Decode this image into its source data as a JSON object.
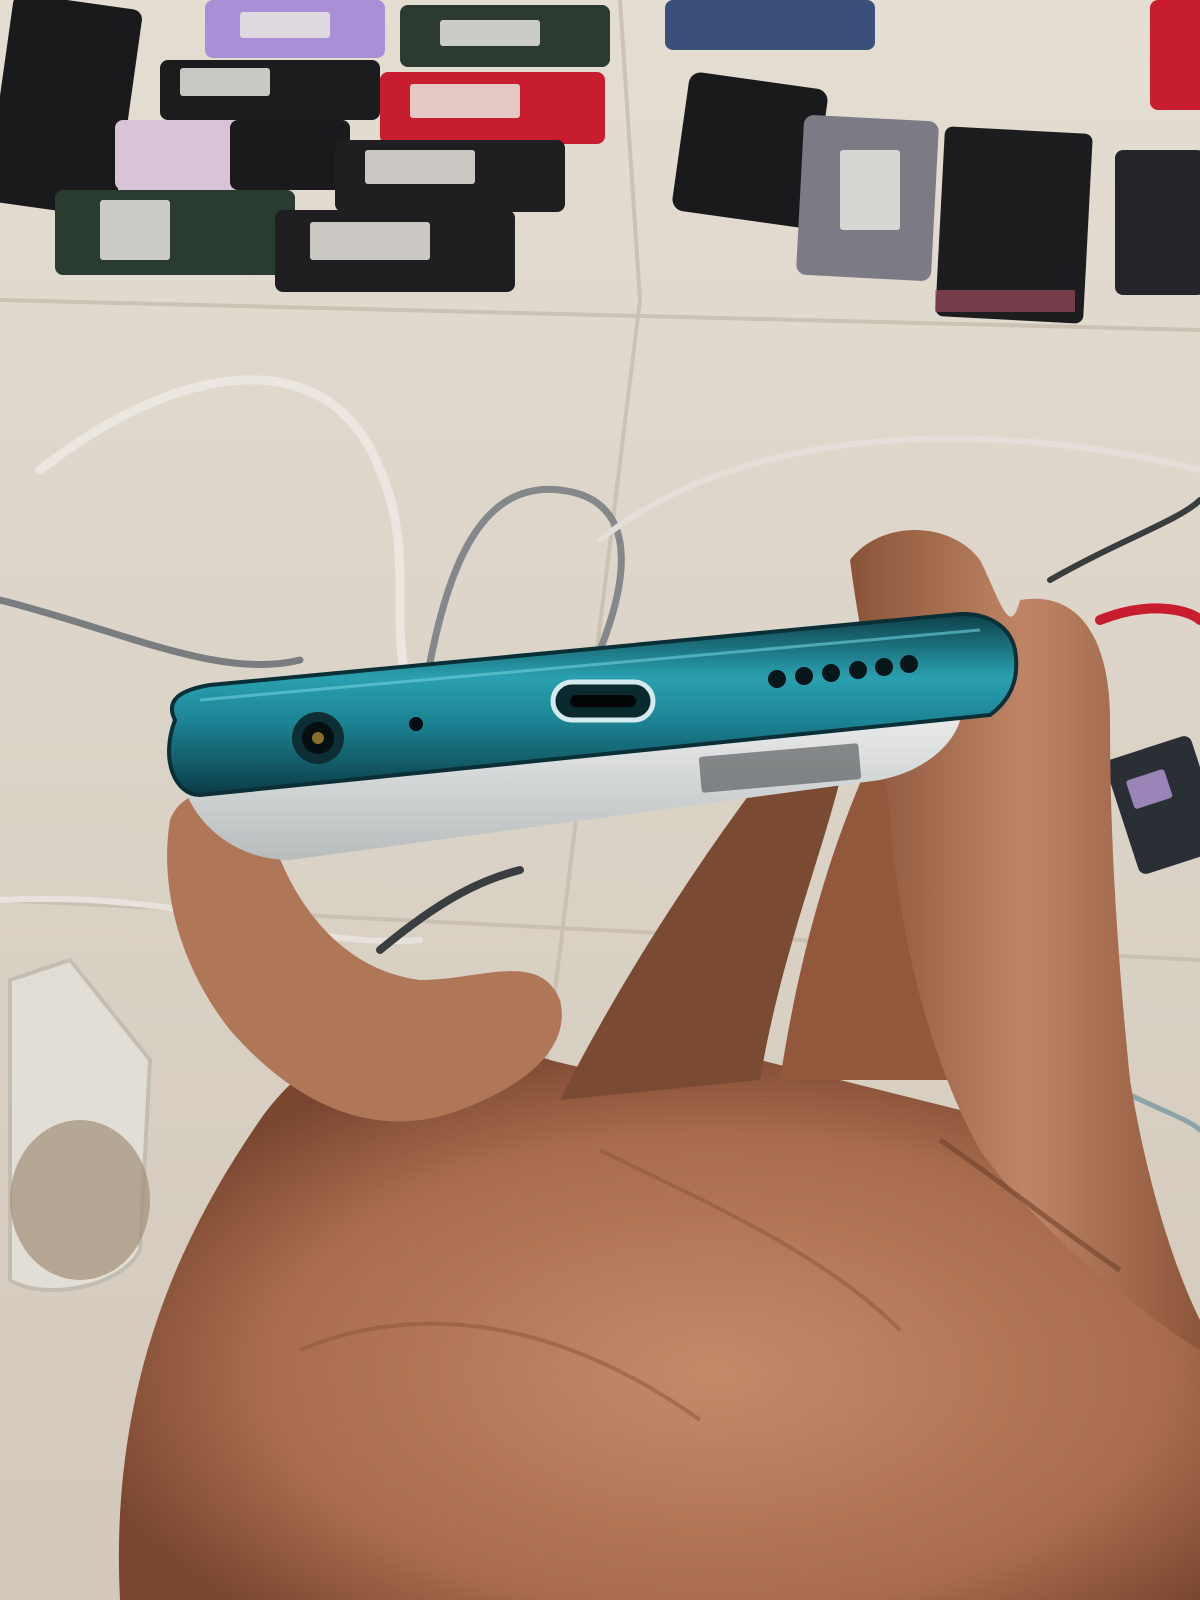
{
  "scene": {
    "description_label": "",
    "colors": {
      "floor": "#d9d1c6",
      "floor_light": "#ece7dd",
      "tile_grout": "#c9c0b2",
      "phone_body_teal": "#1f8a9a",
      "phone_body_dark": "#0f4f5b",
      "phone_back": "#d6d9da",
      "skin": "#b57a5c",
      "skin_shadow": "#7e4b33",
      "skin_highlight": "#d49b7c",
      "cable_white": "#e8e4dd",
      "cable_gray": "#8a8d8e",
      "accent_red": "#c81d2f"
    },
    "background_phones": [
      {
        "color": "#a98fd6"
      },
      {
        "color": "#2c3a2f"
      },
      {
        "color": "#1c1c1f"
      },
      {
        "color": "#c81d2f"
      },
      {
        "color": "#d8c3d8"
      },
      {
        "color": "#1a1a1c"
      },
      {
        "color": "#2a3b2f"
      },
      {
        "color": "#1f1f22"
      },
      {
        "color": "#3a4f7a"
      },
      {
        "color": "#1a1a1c"
      },
      {
        "color": "#7c7a84"
      },
      {
        "color": "#1d1d20"
      },
      {
        "color": "#24252a"
      }
    ],
    "phone_ports": [
      "headphone-jack-icon",
      "microphone-hole-icon",
      "usb-c-port-icon",
      "speaker-grille-icon"
    ]
  }
}
